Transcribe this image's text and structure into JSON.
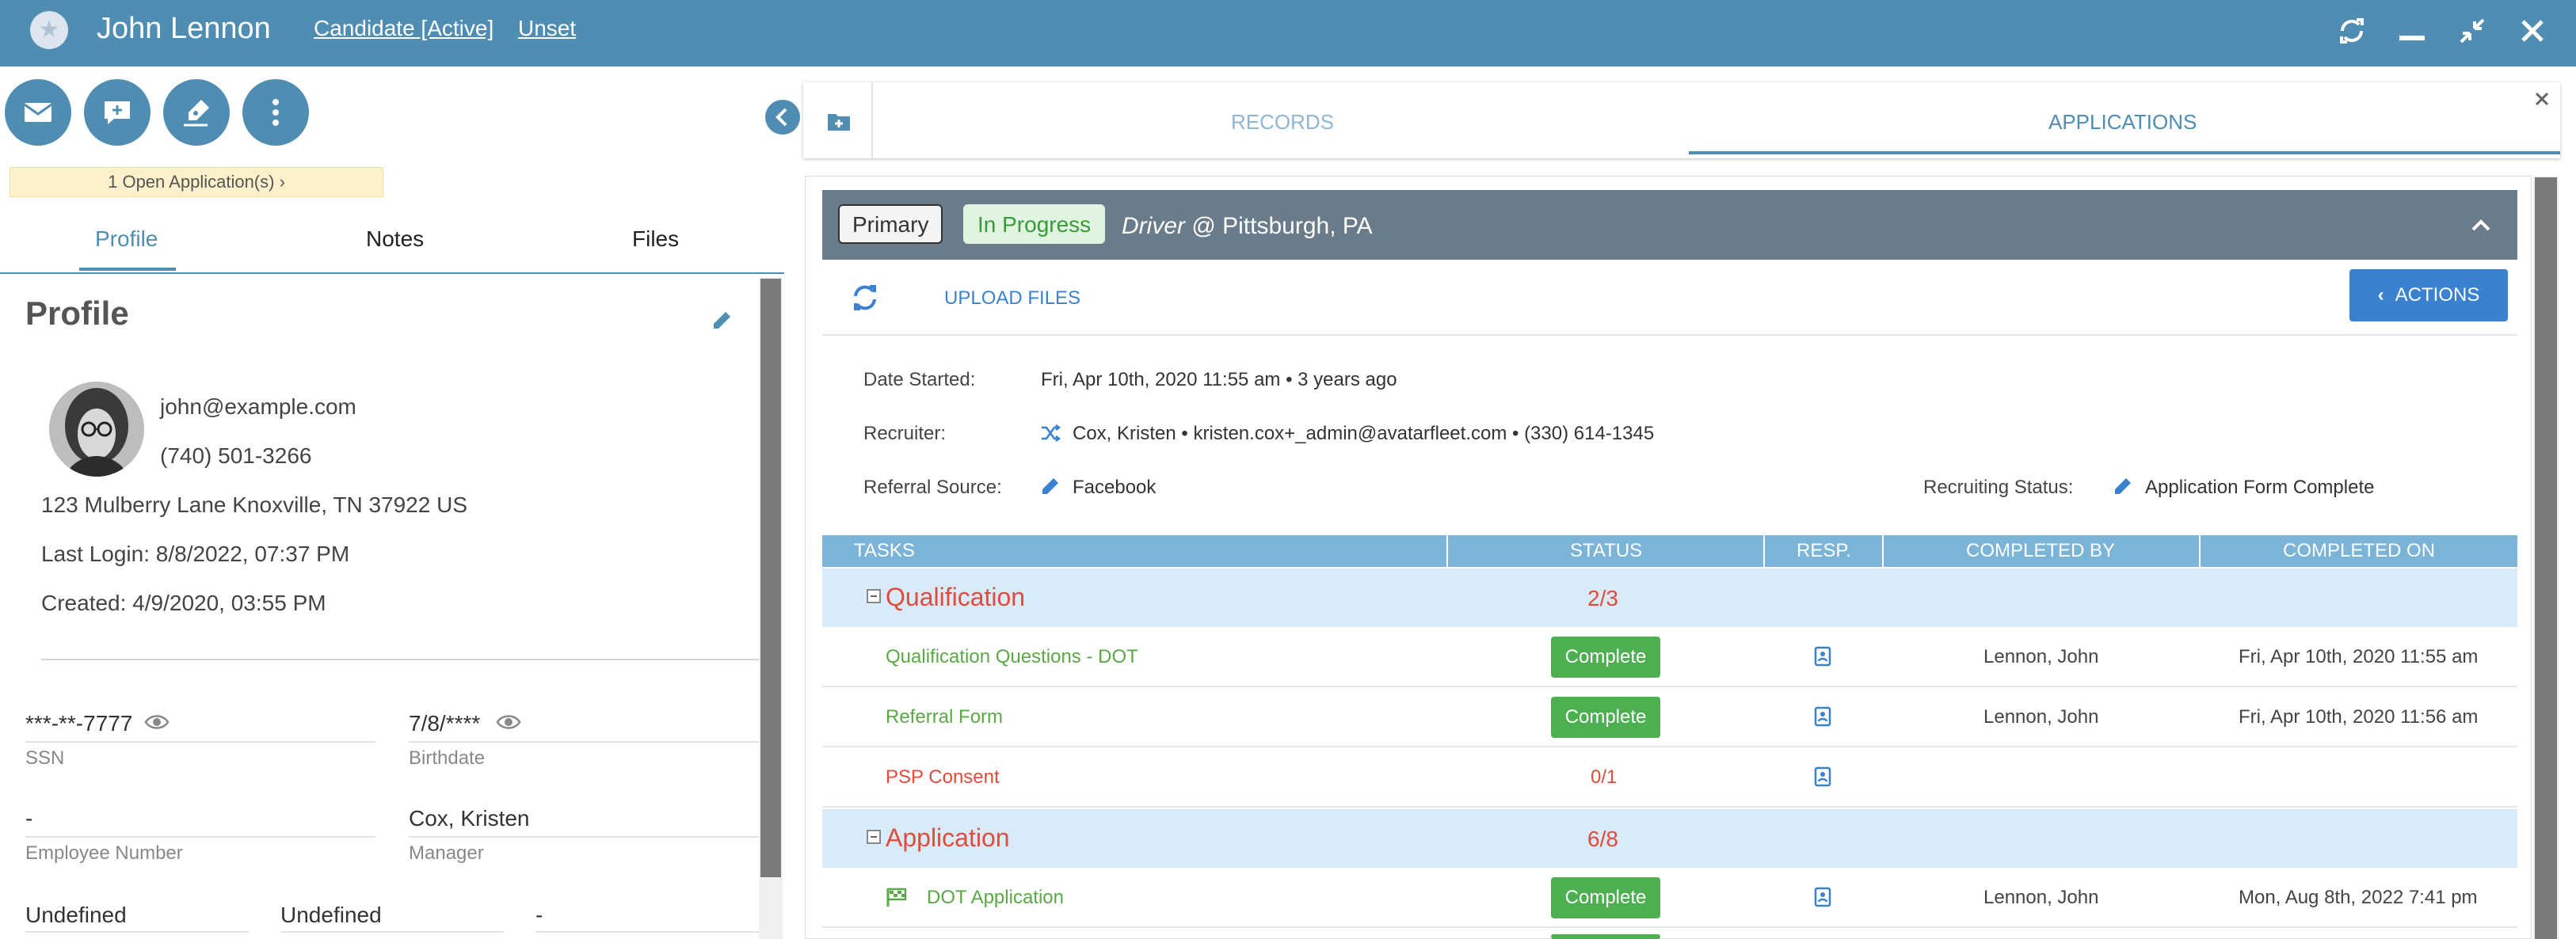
{
  "header": {
    "name": "John Lennon",
    "status_link": "Candidate [Active]",
    "unset_link": "Unset"
  },
  "open_applications": "1 Open Application(s) ›",
  "left_tabs": [
    "Profile",
    "Notes",
    "Files"
  ],
  "profile": {
    "title": "Profile",
    "email": "john@example.com",
    "phone": "(740) 501-3266",
    "address": "123 Mulberry Lane Knoxville, TN 37922 US",
    "last_login": "Last Login: 8/8/2022, 07:37 PM",
    "created": "Created: 4/9/2020, 03:55 PM",
    "ssn_value": "***-**-7777",
    "ssn_label": "SSN",
    "birthdate_value": "7/8/****",
    "birthdate_label": "Birthdate",
    "employee_number_value": "-",
    "employee_number_label": "Employee Number",
    "manager_value": "Cox, Kristen",
    "manager_label": "Manager",
    "extra1": "Undefined",
    "extra2": "Undefined",
    "extra3": "-"
  },
  "right_tabs": [
    "RECORDS",
    "APPLICATIONS"
  ],
  "application": {
    "primary_badge": "Primary",
    "status_badge": "In Progress",
    "position": "Driver",
    "location": " @ Pittsburgh, PA",
    "upload_files": "UPLOAD FILES",
    "actions_button": "ACTIONS",
    "date_started_label": "Date Started:",
    "date_started_value": "Fri, Apr 10th, 2020 11:55 am • 3 years ago",
    "recruiter_label": "Recruiter:",
    "recruiter_name": "Cox, Kristen",
    "recruiter_details": " • kristen.cox+_admin@avatarfleet.com • (330) 614-1345",
    "referral_label": "Referral Source:",
    "referral_value": "Facebook",
    "recruiting_status_label": "Recruiting Status:",
    "recruiting_status_value": "Application Form Complete"
  },
  "tasks_table": {
    "headers": [
      "TASKS",
      "STATUS",
      "RESP.",
      "COMPLETED BY",
      "COMPLETED ON"
    ],
    "groups": [
      {
        "name": "Qualification",
        "count": "2/3"
      },
      {
        "name": "Application",
        "count": "6/8"
      }
    ],
    "rows": [
      {
        "task": "Qualification Questions - DOT",
        "status": "Complete",
        "completed_by": "Lennon, John",
        "completed_on": "Fri, Apr 10th, 2020 11:55 am"
      },
      {
        "task": "Referral Form",
        "status": "Complete",
        "completed_by": "Lennon, John",
        "completed_on": "Fri, Apr 10th, 2020 11:56 am"
      },
      {
        "task": "PSP Consent",
        "status": "0/1",
        "completed_by": "",
        "completed_on": ""
      },
      {
        "task": "DOT Application",
        "status": "Complete",
        "completed_by": "Lennon, John",
        "completed_on": "Mon, Aug 8th, 2022 7:41 pm"
      }
    ]
  },
  "colors": {
    "brand": "#4f8db3",
    "complete_green": "#4caf50",
    "task_red": "#e04b3c",
    "task_green": "#5aa846",
    "accent_blue": "#3a82d0"
  },
  "icons": [
    "star-icon",
    "refresh-icon",
    "minimize-icon",
    "shrink-icon",
    "close-icon",
    "email-icon",
    "comment-icon",
    "sign-icon",
    "more-icon",
    "collapse-left-icon",
    "folder-plus-icon",
    "close-panel-icon",
    "chevron-up-icon",
    "sync-icon",
    "chevron-left-icon",
    "edit-icon",
    "eye-icon",
    "shuffle-icon",
    "pencil-icon",
    "collapse-icon",
    "contact-icon",
    "flag-icon"
  ]
}
